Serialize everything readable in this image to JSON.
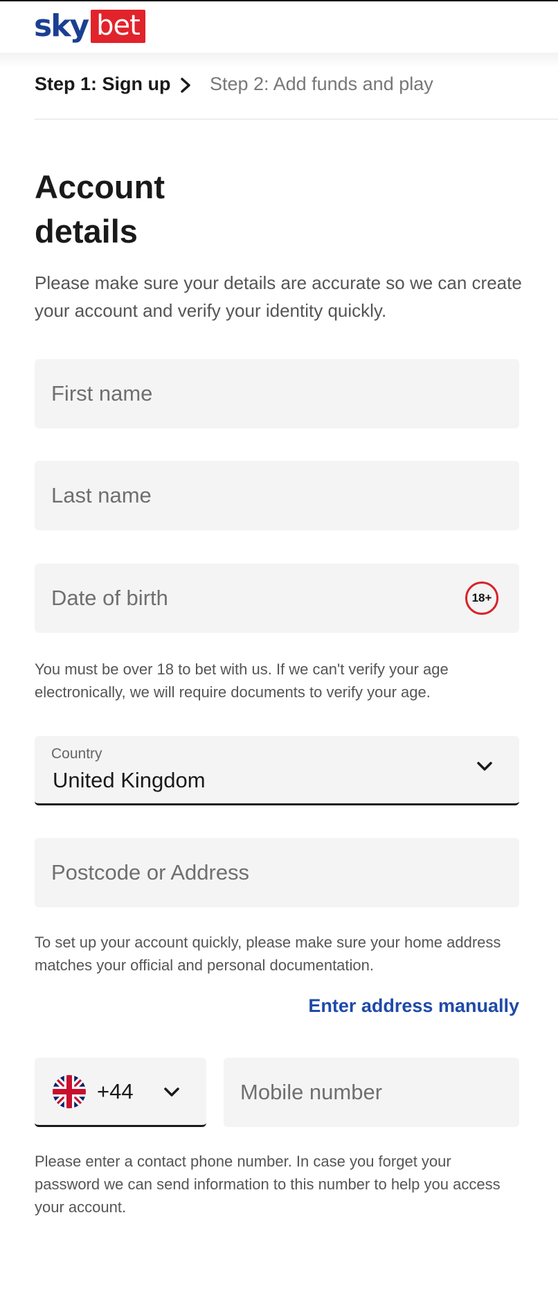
{
  "brand": {
    "logo_sky": "sky",
    "logo_bet": "bet",
    "colors": {
      "sky_blue": "#1b3f91",
      "bet_red": "#e1232b",
      "link_blue": "#1f4aa8"
    }
  },
  "steps": {
    "step1": "Step 1: Sign up",
    "step2": "Step 2: Add funds and play",
    "separator_icon": "chevron-right-icon"
  },
  "form": {
    "title": "Account details",
    "intro": "Please make sure your details are accurate so we can create your account and verify your identity quickly.",
    "first_name": {
      "placeholder": "First name",
      "value": ""
    },
    "last_name": {
      "placeholder": "Last name",
      "value": ""
    },
    "dob": {
      "placeholder": "Date of birth",
      "value": "",
      "badge": "18+"
    },
    "age_help": "You must be over 18 to bet with us. If we can't verify your age electronically, we will require documents to verify your age.",
    "country": {
      "label": "Country",
      "value": "United Kingdom",
      "icon": "chevron-down-icon"
    },
    "address": {
      "placeholder": "Postcode or Address",
      "value": ""
    },
    "address_help": "To set up your account quickly, please make sure your home address matches your official and personal documentation.",
    "manual_address_link": "Enter address manually",
    "phone": {
      "country_code": "+44",
      "flag": "uk-flag-icon",
      "mobile_placeholder": "Mobile number",
      "mobile_value": ""
    },
    "phone_help": "Please enter a contact phone number. In case you forget your password we can send information to this number to help you access your account."
  }
}
